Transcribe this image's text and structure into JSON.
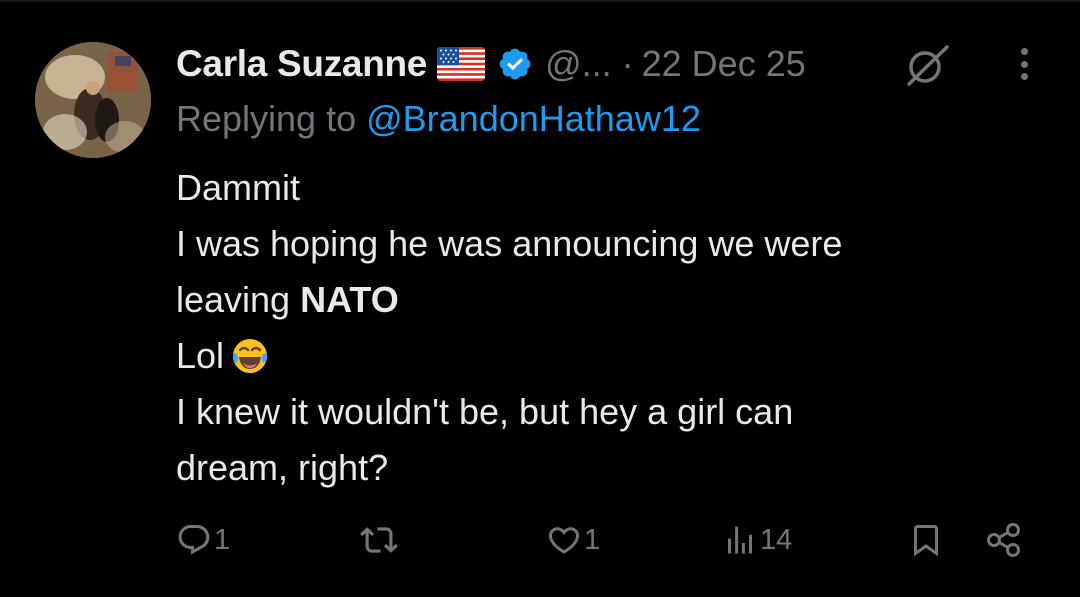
{
  "tweet": {
    "author_name": "Carla Suzanne",
    "handle": "@...",
    "separator": "·",
    "date": "22 Dec 25",
    "reply_prefix": "Replying to ",
    "reply_mention": "@BrandonHathaw12",
    "lines": {
      "l1": "Dammit",
      "l2": "I was hoping he was announcing we were",
      "l3_prefix": "leaving ",
      "l3_bold": "NATO",
      "l4": "Lol",
      "l5": "I knew it wouldn't be, but hey a girl can",
      "l6": "dream, right?"
    }
  },
  "actions": {
    "replies": "1",
    "reposts": "",
    "likes": "1",
    "views": "14"
  },
  "icons": {
    "flag": "us-flag-icon",
    "verified": "verified-badge-icon",
    "grok": "grok-icon",
    "more": "more-icon",
    "reply": "reply-icon",
    "repost": "repost-icon",
    "like": "heart-icon",
    "views": "views-icon",
    "bookmark": "bookmark-icon",
    "share": "share-icon",
    "emoji": "tears-of-joy-emoji"
  },
  "colors": {
    "background": "#000000",
    "text": "#e7e9ea",
    "muted": "#71767b",
    "accent": "#1d9bf0"
  }
}
